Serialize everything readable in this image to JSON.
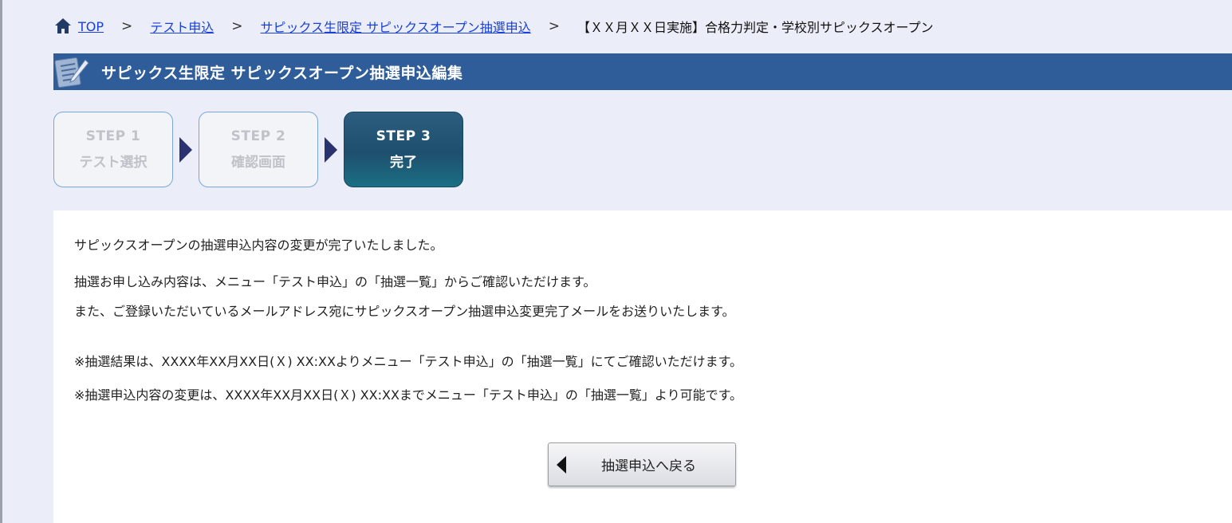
{
  "breadcrumb": {
    "items": [
      "TOP",
      "テスト申込",
      "サピックス生限定 サピックスオープン抽選申込"
    ],
    "separator": ">",
    "current": "【ＸＸ月ＸＸ日実施】合格力判定・学校別サピックスオープン"
  },
  "page": {
    "title": "サピックス生限定 サピックスオープン抽選申込編集"
  },
  "steps": [
    {
      "num": "STEP 1",
      "label": "テスト選択",
      "state": "inactive"
    },
    {
      "num": "STEP 2",
      "label": "確認画面",
      "state": "inactive"
    },
    {
      "num": "STEP 3",
      "label": "完了",
      "state": "active"
    }
  ],
  "messages": [
    "サピックスオープンの抽選申込内容の変更が完了いたしました。",
    "抽選お申し込み内容は、メニュー「テスト申込」の「抽選一覧」からご確認いただけます。",
    "また、ご登録いただいているメールアドレス宛にサピックスオープン抽選申込変更完了メールをお送りいたします。"
  ],
  "notes": [
    "※抽選結果は、XXXX年XX月XX日(Ｘ) XX:XXよりメニュー「テスト申込」の「抽選一覧」にてご確認いただけます。",
    "※抽選申込内容の変更は、XXXX年XX月XX日(Ｘ) XX:XXまでメニュー「テスト申込」の「抽選一覧」より可能です。"
  ],
  "buttons": {
    "back_label": "抽選申込へ戻る"
  },
  "colors": {
    "title_bar": "#2f5d99",
    "active_step": "#1f4f6e",
    "link": "#1a3fd6",
    "background": "#ebeef8"
  },
  "icons": {
    "home": "home-icon",
    "title": "memo-icon",
    "step_arrow": "triangle-right-icon",
    "back": "triangle-left-icon"
  }
}
